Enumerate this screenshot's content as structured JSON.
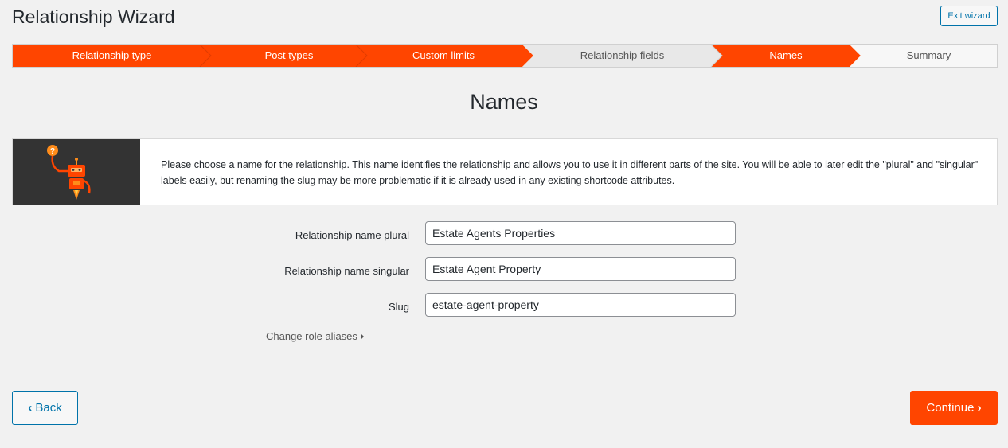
{
  "header": {
    "title": "Relationship Wizard",
    "exit_label": "Exit wizard"
  },
  "steps": [
    {
      "label": "Relationship type",
      "active": true
    },
    {
      "label": "Post types",
      "active": true
    },
    {
      "label": "Custom limits",
      "active": true
    },
    {
      "label": "Relationship fields",
      "active": false
    },
    {
      "label": "Names",
      "active": true
    },
    {
      "label": "Summary",
      "active": false
    }
  ],
  "page": {
    "heading": "Names",
    "info_text": "Please choose a name for the relationship. This name identifies the relationship and allows you to use it in different parts of the site. You will be able to later edit the \"plural\" and \"singular\" labels easily, but renaming the slug may be more problematic if it is already used in any existing shortcode attributes."
  },
  "form": {
    "plural_label": "Relationship name plural",
    "plural_value": "Estate Agents Properties",
    "singular_label": "Relationship name singular",
    "singular_value": "Estate Agent Property",
    "slug_label": "Slug",
    "slug_value": "estate-agent-property",
    "aliases_label": "Change role aliases"
  },
  "buttons": {
    "back": "Back",
    "continue": "Continue"
  },
  "colors": {
    "accent": "#ff4500",
    "link": "#0073aa",
    "inactive_step": "#e8e8e8"
  }
}
